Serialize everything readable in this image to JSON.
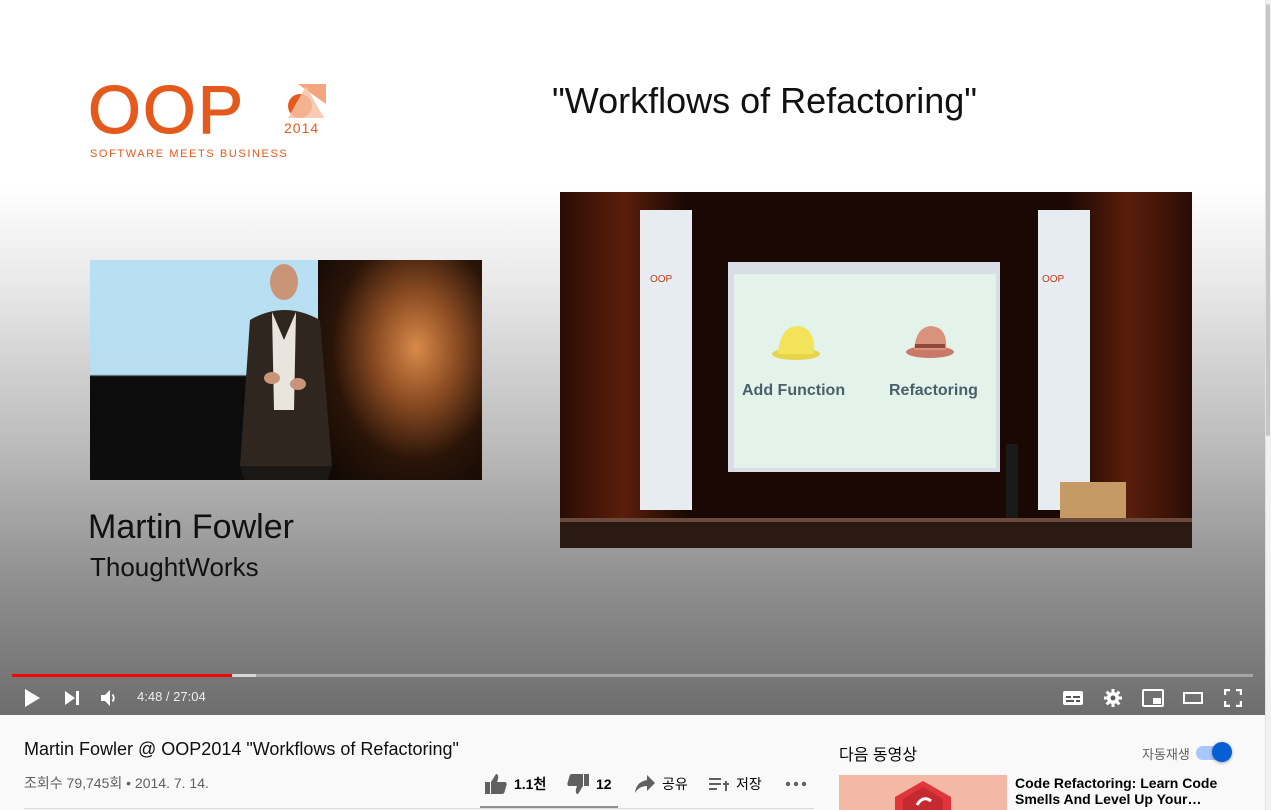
{
  "slide": {
    "logo_letters": "OOP",
    "logo_year": "2014",
    "logo_tagline": "SOFTWARE MEETS BUSINESS",
    "title": "\"Workflows of Refactoring\"",
    "speaker_name": "Martin Fowler",
    "speaker_org": "ThoughtWorks",
    "stage_banner_text": "OOP",
    "hat_labels": [
      "Add Function",
      "Refactoring"
    ]
  },
  "player": {
    "time_current": "4:48",
    "time_total": "27:04",
    "progress_fraction": 0.177,
    "buffer_fraction": 0.197,
    "accent_color": "#ff0000"
  },
  "video": {
    "title": "Martin Fowler @ OOP2014 \"Workflows of Refactoring\"",
    "views": "조회수 79,745회",
    "date": "2014. 7. 14.",
    "likes": "1.1천",
    "dislikes": "12",
    "share_label": "공유",
    "save_label": "저장"
  },
  "sidebar": {
    "up_next_label": "다음 동영상",
    "autoplay_label": "자동재생",
    "autoplay_on": true,
    "recommendations": [
      {
        "title": "Code Refactoring: Learn Code Smells And Level Up Your…"
      }
    ]
  }
}
